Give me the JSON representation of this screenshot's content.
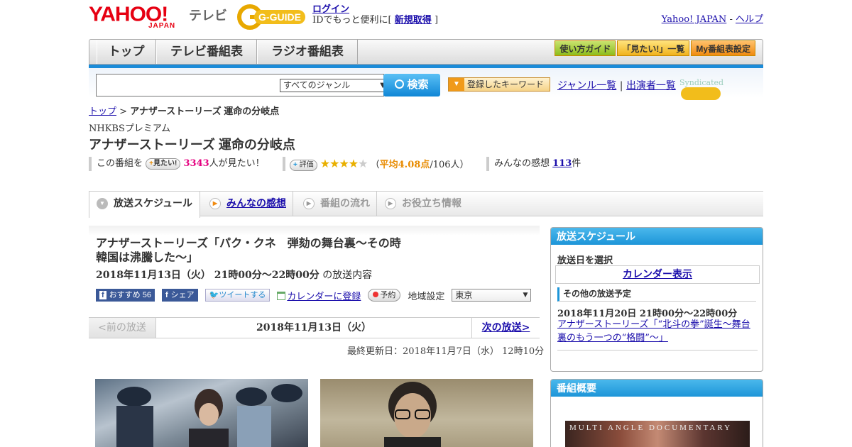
{
  "header": {
    "logo_text": "YAHOO!",
    "logo_sub": "JAPAN",
    "service": "テレビ",
    "gguide_logo": "G-GUIDE",
    "login": "ログイン",
    "login_note": "IDでもっと便利に[",
    "register": "新規取得",
    "login_note_end": "]",
    "yahoo_japan": "Yahoo! JAPAN",
    "sep": "-",
    "help": "ヘルプ"
  },
  "nav": {
    "tabs": [
      "トップ",
      "テレビ番組表",
      "ラジオ番組表"
    ],
    "buttons": [
      "使い方ガイド",
      "「見たい!」一覧",
      "My番組表設定"
    ]
  },
  "search": {
    "genre": "すべてのジャンル",
    "button": "検索",
    "keyword_button": "登録したキーワード",
    "genre_list": "ジャンル一覧",
    "divider": "|",
    "cast_list": "出演者一覧",
    "syndicated": "Syndicated"
  },
  "breadcrumb": {
    "top": "トップ",
    "sep": " > ",
    "current": "アナザーストーリーズ 運命の分岐点"
  },
  "program": {
    "channel": "NHKBSプレミアム",
    "title": "アナザーストーリーズ 運命の分岐点",
    "this_program": "この番組を",
    "want_btn": "見たい!",
    "want_count": "3343",
    "want_suffix": "人が見たい！",
    "rate_btn": "評価",
    "rating_open": "（",
    "rating_avg": "平均4.08点",
    "rating_count": "/106人）",
    "rating_value": 4.08,
    "impressions_label": "みんなの感想",
    "impressions_count": "113",
    "impressions_suffix": "件"
  },
  "tabs": {
    "schedule": "放送スケジュール",
    "impressions": "みんなの感想",
    "flow": "番組の流れ",
    "useful": "お役立ち情報"
  },
  "episode": {
    "title_line1": "アナザーストーリーズ「パク・クネ　弾劾の舞台裏～その時",
    "title_line2": "韓国は沸騰した～」",
    "date": "2018年11月13日（火）  21時00分～22時00分",
    "date_suffix": "の放送内容",
    "fb_recommend": "おすすめ",
    "fb_count": "56",
    "fb_share": "シェア",
    "tweet": "ツイートする",
    "calendar": "カレンダーに登録",
    "reserve": "予約",
    "region_label": "地域設定",
    "region": "東京",
    "prev": "<前の放送",
    "current_date": "2018年11月13日（火）",
    "next": "次の放送>",
    "updated": "最終更新日：2018年11月7日（水）  12時10分"
  },
  "side": {
    "schedule_head": "放送スケジュール",
    "select_date": "放送日を選択",
    "calendar_show": "カレンダー表示",
    "other_schedule": "その他の放送予定",
    "other_date": "2018年11月20日  21時00分～22時00分",
    "other_link": "アナザーストーリーズ「“北斗の拳”誕生～舞台裏のもう一つの“格闘”～」",
    "overview_head": "番組概要",
    "overview_image_text": "MULTI ANGLE DOCUMENTARY"
  }
}
